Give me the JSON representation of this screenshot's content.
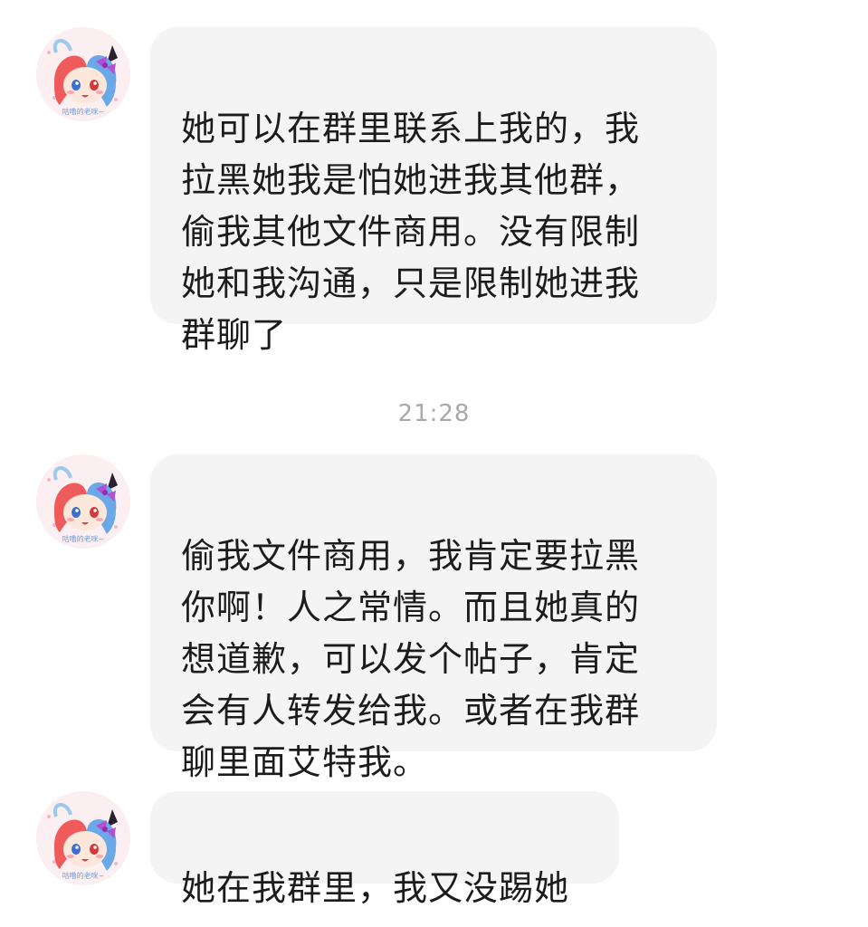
{
  "conversation": {
    "messages": [
      {
        "text": "她可以在群里联系上我的，我\n拉黑她我是怕她进我其他群，\n偷我其他文件商用。没有限制\n她和我沟通，只是限制她进我\n群聊了"
      },
      {
        "text": "偷我文件商用，我肯定要拉黑\n你啊！人之常情。而且她真的\n想道歉，可以发个帖子，肯定\n会有人转发给我。或者在我群\n聊里面艾特我。"
      },
      {
        "text": "她在我群里，我又没踢她"
      }
    ],
    "timestamp": "21:28",
    "avatar_caption": "咕噜的老咪~"
  },
  "colors": {
    "bubble_bg": "#f4f4f4",
    "text": "#1c1c1c",
    "timestamp": "#a9a9a9",
    "avatar_hair_left": "#ef5a5a",
    "avatar_hair_right": "#6aa8e8",
    "avatar_ribbon": "#b44fd0"
  },
  "icons": {
    "avatar": "anime-avatar-icon"
  }
}
